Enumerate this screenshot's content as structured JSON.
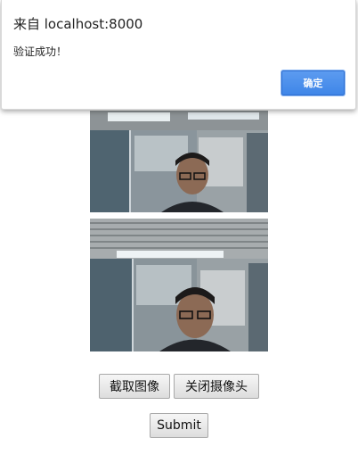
{
  "dialog": {
    "title": "来自 localhost:8000",
    "message": "验证成功！",
    "ok_label": "确定"
  },
  "controls": {
    "capture_label": "截取图像",
    "close_camera_label": "关闭摄像头",
    "submit_label": "Submit"
  },
  "colors": {
    "ok_button": "#4a8fec",
    "button_face": "#e8e8e8",
    "background": "#ffffff"
  }
}
